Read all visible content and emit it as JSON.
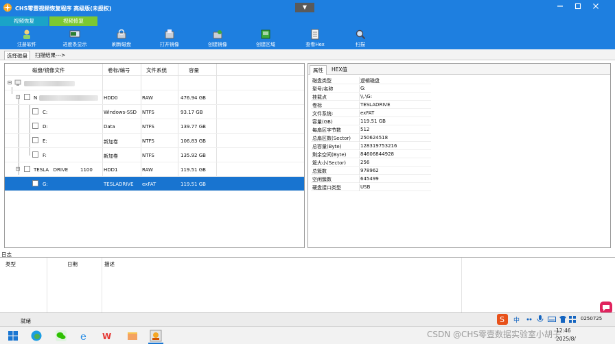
{
  "window": {
    "title": "CHS零壹视频恢复程序 高级版(未授权)",
    "mid_button": "▼"
  },
  "tabs": [
    "视频恢复",
    "视频修复"
  ],
  "toolbar": {
    "buttons": [
      "注册软件",
      "进度条显示",
      "刷新磁盘",
      "打开镜像",
      "创建镜像",
      "创建区域",
      "查看Hex",
      "扫描"
    ]
  },
  "subtabs": {
    "active": "选择磁盘",
    "other": "扫描结果--->"
  },
  "disk_table": {
    "headers": [
      "磁盘/镜像文件",
      "卷标/编号",
      "文件系统",
      "容量"
    ],
    "rows": [
      {
        "name": "",
        "label": "",
        "fs": "",
        "size": ""
      },
      {
        "name": "N",
        "label": "HDD0",
        "fs": "RAW",
        "size": "476.94 GB"
      },
      {
        "name": "C:",
        "label": "Windows-SSD",
        "fs": "NTFS",
        "size": "93.17 GB"
      },
      {
        "name": "D:",
        "label": "Data",
        "fs": "NTFS",
        "size": "139.77 GB"
      },
      {
        "name": "E:",
        "label": "新加卷",
        "fs": "NTFS",
        "size": "106.83 GB"
      },
      {
        "name": "F:",
        "label": "新加卷",
        "fs": "NTFS",
        "size": "135.92 GB"
      },
      {
        "name": "TESLA   DRIVE        1100",
        "label": "HDD1",
        "fs": "RAW",
        "size": "119.51 GB"
      },
      {
        "name": "G:",
        "label": "TESLADRIVE",
        "fs": "exFAT",
        "size": "119.51 GB"
      }
    ]
  },
  "prop_tabs": {
    "active": "属性",
    "other": "HEX值"
  },
  "properties": [
    {
      "k": "磁盘类型",
      "v": "逻辑磁盘"
    },
    {
      "k": "型号/名称",
      "v": "G:"
    },
    {
      "k": "挂载点",
      "v": "\\\\.\\G:"
    },
    {
      "k": "卷标",
      "v": "TESLADRIVE"
    },
    {
      "k": "文件系统:",
      "v": "exFAT"
    },
    {
      "k": "容量(GB)",
      "v": "119.51 GB"
    },
    {
      "k": "每扇区字节数",
      "v": "512"
    },
    {
      "k": "总扇区数(Sector)",
      "v": "250624518"
    },
    {
      "k": "总容量(Byte)",
      "v": "128319753216"
    },
    {
      "k": "剩余空间(Byte)",
      "v": "84606844928"
    },
    {
      "k": "簇大小(Sector)",
      "v": "256"
    },
    {
      "k": "总簇数",
      "v": "978962"
    },
    {
      "k": "空闲簇数",
      "v": "645499"
    },
    {
      "k": "硬盘接口类型",
      "v": "USB"
    }
  ],
  "log": {
    "label": "日志",
    "headers": [
      "类型",
      "日期",
      "描述"
    ]
  },
  "status": {
    "text": "就绪",
    "code": "0250725"
  },
  "ime": {
    "mode": "中"
  },
  "taskbar": {
    "time": "12:46",
    "date": "2025/8/",
    "watermark": "CSDN @CHS零壹数据实验室小胡子"
  },
  "colors": {
    "titlebar": "#1e7fe0",
    "selection": "#1874d0",
    "tab_recover": "#1aa3c8",
    "tab_repair": "#7cc832"
  }
}
